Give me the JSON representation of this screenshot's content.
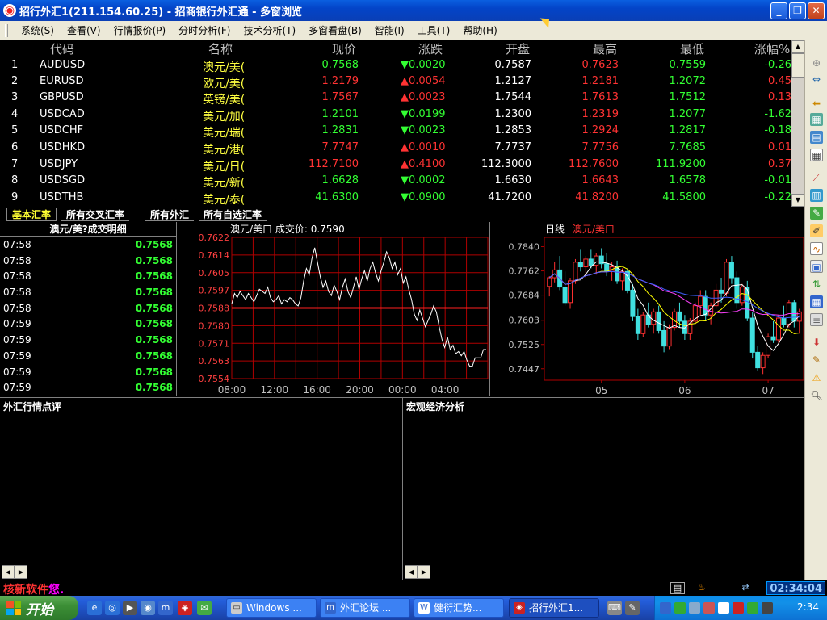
{
  "window": {
    "title": "招行外汇1(211.154.60.25) - 招商银行外汇通 - 多窗浏览"
  },
  "menu": [
    "系统(S)",
    "查看(V)",
    "行情报价(P)",
    "分时分析(F)",
    "技术分析(T)",
    "多窗看盘(B)",
    "智能(I)",
    "工具(T)",
    "帮助(H)"
  ],
  "quote_table": {
    "headers": {
      "code": "代码",
      "name": "名称",
      "price": "现价",
      "change": "涨跌",
      "open": "开盘",
      "high": "最高",
      "low": "最低",
      "pct": "涨幅%"
    },
    "rows": [
      {
        "no": "1",
        "code": "AUDUSD",
        "name": "澳元/美(",
        "price": "0.7568",
        "dir": "down",
        "change": "0.0020",
        "open": "0.7587",
        "high": "0.7623",
        "low": "0.7559",
        "pct": "-0.26"
      },
      {
        "no": "2",
        "code": "EURUSD",
        "name": "欧元/美(",
        "price": "1.2179",
        "dir": "up",
        "change": "0.0054",
        "open": "1.2127",
        "high": "1.2181",
        "low": "1.2072",
        "pct": "0.45"
      },
      {
        "no": "3",
        "code": "GBPUSD",
        "name": "英镑/美(",
        "price": "1.7567",
        "dir": "up",
        "change": "0.0023",
        "open": "1.7544",
        "high": "1.7613",
        "low": "1.7512",
        "pct": "0.13"
      },
      {
        "no": "4",
        "code": "USDCAD",
        "name": "美元/加(",
        "price": "1.2101",
        "dir": "down",
        "change": "0.0199",
        "open": "1.2300",
        "high": "1.2319",
        "low": "1.2077",
        "pct": "-1.62"
      },
      {
        "no": "5",
        "code": "USDCHF",
        "name": "美元/瑞(",
        "price": "1.2831",
        "dir": "down",
        "change": "0.0023",
        "open": "1.2853",
        "high": "1.2924",
        "low": "1.2817",
        "pct": "-0.18"
      },
      {
        "no": "6",
        "code": "USDHKD",
        "name": "美元/港(",
        "price": "7.7747",
        "dir": "up",
        "change": "0.0010",
        "open": "7.7737",
        "high": "7.7756",
        "low": "7.7685",
        "pct": "0.01"
      },
      {
        "no": "7",
        "code": "USDJPY",
        "name": "美元/日(",
        "price": "112.7100",
        "dir": "up",
        "change": "0.4100",
        "open": "112.3000",
        "high": "112.7600",
        "low": "111.9200",
        "pct": "0.37"
      },
      {
        "no": "8",
        "code": "USDSGD",
        "name": "美元/新(",
        "price": "1.6628",
        "dir": "down",
        "change": "0.0002",
        "open": "1.6630",
        "high": "1.6643",
        "low": "1.6578",
        "pct": "-0.01"
      },
      {
        "no": "9",
        "code": "USDTHB",
        "name": "美元/泰(",
        "price": "41.6300",
        "dir": "down",
        "change": "0.0900",
        "open": "41.7200",
        "high": "41.8200",
        "low": "41.5800",
        "pct": "-0.22"
      }
    ]
  },
  "tabs": [
    "基本汇率",
    "所有交叉汇率",
    "所有外汇",
    "所有自选汇率"
  ],
  "trade_detail": {
    "title": "澳元/美?成交明细",
    "rows": [
      {
        "time": "07:58",
        "price": "0.7568"
      },
      {
        "time": "07:58",
        "price": "0.7568"
      },
      {
        "time": "07:58",
        "price": "0.7568"
      },
      {
        "time": "07:58",
        "price": "0.7568"
      },
      {
        "time": "07:58",
        "price": "0.7568"
      },
      {
        "time": "07:59",
        "price": "0.7568"
      },
      {
        "time": "07:59",
        "price": "0.7568"
      },
      {
        "time": "07:59",
        "price": "0.7568"
      },
      {
        "time": "07:59",
        "price": "0.7568"
      },
      {
        "time": "07:59",
        "price": "0.7568"
      }
    ]
  },
  "chart_data": [
    {
      "type": "line",
      "title": "澳元/美口 成交价: 0.7590",
      "reference_price": 0.7588,
      "y_ticks": [
        "0.7622",
        "0.7614",
        "0.7605",
        "0.7597",
        "0.7588",
        "0.7580",
        "0.7571",
        "0.7563",
        "0.7554"
      ],
      "x_ticks": [
        "08:00",
        "12:00",
        "16:00",
        "20:00",
        "00:00",
        "04:00"
      ],
      "ylim": [
        0.7554,
        0.7622
      ],
      "values": [
        0.759,
        0.7595,
        0.7593,
        0.7596,
        0.7594,
        0.7592,
        0.7595,
        0.7593,
        0.7591,
        0.7594,
        0.7597,
        0.7596,
        0.7595,
        0.7598,
        0.7593,
        0.7591,
        0.7592,
        0.7594,
        0.759,
        0.7592,
        0.7591,
        0.7593,
        0.7592,
        0.759,
        0.7589,
        0.7593,
        0.7601,
        0.7607,
        0.7604,
        0.7612,
        0.7617,
        0.761,
        0.7603,
        0.7598,
        0.7601,
        0.7596,
        0.7594,
        0.7599,
        0.7596,
        0.7592,
        0.7598,
        0.7602,
        0.7596,
        0.7593,
        0.7598,
        0.7603,
        0.7597,
        0.7602,
        0.7606,
        0.7601,
        0.7607,
        0.761,
        0.7605,
        0.7601,
        0.7606,
        0.761,
        0.7615,
        0.7612,
        0.7607,
        0.761,
        0.7604,
        0.7607,
        0.76,
        0.7603,
        0.7597,
        0.7592,
        0.7585,
        0.7582,
        0.7587,
        0.7583,
        0.7579,
        0.7582,
        0.7585,
        0.7589,
        0.7586,
        0.7579,
        0.7573,
        0.7569,
        0.7574,
        0.7568,
        0.757,
        0.7566,
        0.7567,
        0.7565,
        0.7567,
        0.7563,
        0.756,
        0.756,
        0.7564,
        0.7564,
        0.7564,
        0.7568,
        0.7568
      ]
    },
    {
      "type": "candlestick",
      "title": "日线",
      "series_label": "澳元/美口",
      "y_ticks": [
        "0.7840",
        "0.7762",
        "0.7684",
        "0.7603",
        "0.7525",
        "0.7447"
      ],
      "x_ticks": [
        "05",
        "06",
        "07"
      ],
      "ylim": [
        0.741,
        0.787
      ],
      "candles": [
        [
          0.7712,
          0.7745,
          0.768,
          0.774
        ],
        [
          0.774,
          0.779,
          0.7725,
          0.7765
        ],
        [
          0.7765,
          0.781,
          0.77,
          0.771
        ],
        [
          0.771,
          0.776,
          0.765,
          0.766
        ],
        [
          0.766,
          0.774,
          0.764,
          0.773
        ],
        [
          0.773,
          0.78,
          0.772,
          0.779
        ],
        [
          0.779,
          0.783,
          0.776,
          0.7775
        ],
        [
          0.7775,
          0.781,
          0.774,
          0.78
        ],
        [
          0.78,
          0.783,
          0.777,
          0.778
        ],
        [
          0.778,
          0.782,
          0.775,
          0.781
        ],
        [
          0.781,
          0.7835,
          0.777,
          0.7785
        ],
        [
          0.7785,
          0.782,
          0.7745,
          0.776
        ],
        [
          0.776,
          0.779,
          0.773,
          0.7775
        ],
        [
          0.7775,
          0.7795,
          0.772,
          0.773
        ],
        [
          0.773,
          0.777,
          0.77,
          0.776
        ],
        [
          0.776,
          0.777,
          0.769,
          0.77
        ],
        [
          0.77,
          0.772,
          0.76,
          0.7615
        ],
        [
          0.7615,
          0.764,
          0.754,
          0.756
        ],
        [
          0.756,
          0.763,
          0.755,
          0.762
        ],
        [
          0.762,
          0.766,
          0.758,
          0.759
        ],
        [
          0.759,
          0.764,
          0.756,
          0.763
        ],
        [
          0.763,
          0.765,
          0.756,
          0.757
        ],
        [
          0.757,
          0.76,
          0.75,
          0.752
        ],
        [
          0.752,
          0.759,
          0.751,
          0.758
        ],
        [
          0.758,
          0.764,
          0.757,
          0.763
        ],
        [
          0.763,
          0.766,
          0.758,
          0.76
        ],
        [
          0.76,
          0.762,
          0.754,
          0.756
        ],
        [
          0.756,
          0.761,
          0.754,
          0.76
        ],
        [
          0.76,
          0.766,
          0.759,
          0.765
        ],
        [
          0.765,
          0.77,
          0.762,
          0.768
        ],
        [
          0.768,
          0.77,
          0.76,
          0.762
        ],
        [
          0.762,
          0.766,
          0.759,
          0.765
        ],
        [
          0.765,
          0.772,
          0.764,
          0.77
        ],
        [
          0.77,
          0.774,
          0.766,
          0.769
        ],
        [
          0.769,
          0.78,
          0.768,
          0.779
        ],
        [
          0.779,
          0.781,
          0.772,
          0.774
        ],
        [
          0.774,
          0.776,
          0.764,
          0.766
        ],
        [
          0.766,
          0.772,
          0.765,
          0.771
        ],
        [
          0.771,
          0.773,
          0.76,
          0.761
        ],
        [
          0.761,
          0.763,
          0.748,
          0.75
        ],
        [
          0.75,
          0.752,
          0.744,
          0.745
        ],
        [
          0.745,
          0.75,
          0.743,
          0.749
        ],
        [
          0.749,
          0.756,
          0.748,
          0.755
        ],
        [
          0.755,
          0.76,
          0.753,
          0.754
        ],
        [
          0.754,
          0.762,
          0.753,
          0.761
        ],
        [
          0.761,
          0.765,
          0.758,
          0.759
        ],
        [
          0.759,
          0.767,
          0.758,
          0.766
        ],
        [
          0.766,
          0.767,
          0.758,
          0.76
        ],
        [
          0.76,
          0.764,
          0.756,
          0.763
        ]
      ]
    }
  ],
  "panels": {
    "left_title": "外汇行情点评",
    "right_title": "宏观经济分析"
  },
  "status": {
    "brand": "核新软件",
    "brand_tail": "您.",
    "clock": "02:34:04"
  },
  "taskbar": {
    "start": "开始",
    "tasks": [
      "Windows ...",
      "外汇论坛 ...",
      "健衍汇势...",
      "招行外汇1..."
    ],
    "time": "2:34"
  }
}
